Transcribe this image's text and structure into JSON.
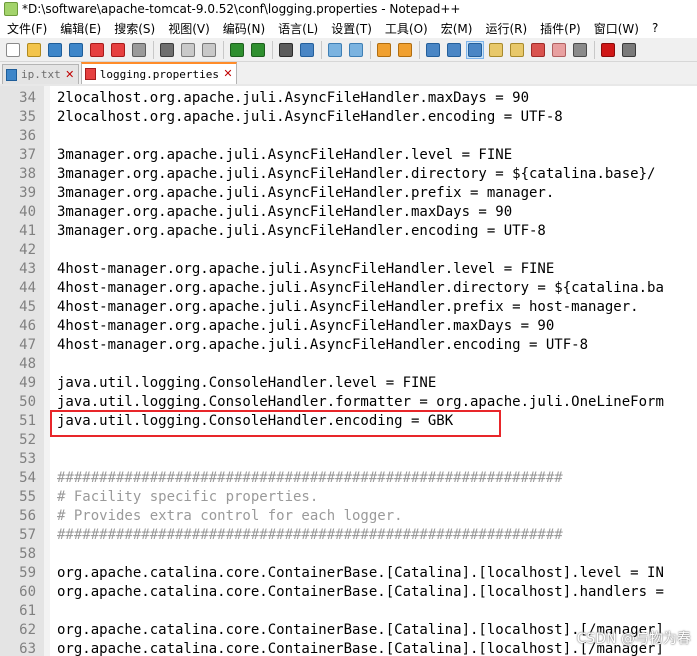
{
  "window": {
    "title": "*D:\\software\\apache-tomcat-9.0.52\\conf\\logging.properties - Notepad++"
  },
  "menubar": {
    "items": [
      "文件(F)",
      "编辑(E)",
      "搜索(S)",
      "视图(V)",
      "编码(N)",
      "语言(L)",
      "设置(T)",
      "工具(O)",
      "宏(M)",
      "运行(R)",
      "插件(P)",
      "窗口(W)",
      "?"
    ]
  },
  "toolbar": {
    "buttons": [
      {
        "icon": "new-file-icon",
        "color": "#ffffff",
        "border": "#8a8a8a"
      },
      {
        "icon": "open-file-icon",
        "color": "#f3c44b",
        "border": "#b08a1e"
      },
      {
        "icon": "save-icon",
        "color": "#3e86c9",
        "border": "#1e5d99"
      },
      {
        "icon": "save-all-icon",
        "color": "#3e86c9",
        "border": "#1e5d99"
      },
      {
        "icon": "close-file-icon",
        "color": "#e64040",
        "border": "#a61b1b"
      },
      {
        "icon": "close-all-icon",
        "color": "#e64040",
        "border": "#a61b1b"
      },
      {
        "icon": "print-icon",
        "color": "#9a9a9a",
        "border": "#5c5c5c"
      },
      {
        "sep": true
      },
      {
        "icon": "cut-icon",
        "color": "#6f6f6f",
        "border": "#3c3c3c"
      },
      {
        "icon": "copy-icon",
        "color": "#c9c9c9",
        "border": "#7a7a7a"
      },
      {
        "icon": "paste-icon",
        "color": "#c9c9c9",
        "border": "#7a7a7a"
      },
      {
        "sep": true
      },
      {
        "icon": "undo-icon",
        "color": "#2f8f2f",
        "border": "#1d5e1d"
      },
      {
        "icon": "redo-icon",
        "color": "#2f8f2f",
        "border": "#1d5e1d"
      },
      {
        "sep": true
      },
      {
        "icon": "find-icon",
        "color": "#5c5c5c",
        "border": "#2c2c2c"
      },
      {
        "icon": "replace-icon",
        "color": "#4a86c5",
        "border": "#245f9b"
      },
      {
        "sep": true
      },
      {
        "icon": "zoom-in-icon",
        "color": "#7bb3e0",
        "border": "#3f7fb5"
      },
      {
        "icon": "zoom-out-icon",
        "color": "#7bb3e0",
        "border": "#3f7fb5"
      },
      {
        "sep": true
      },
      {
        "icon": "sync-vertical-icon",
        "color": "#f0a030",
        "border": "#b06d10"
      },
      {
        "icon": "sync-horizontal-icon",
        "color": "#f0a030",
        "border": "#b06d10"
      },
      {
        "sep": true
      },
      {
        "icon": "word-wrap-icon",
        "color": "#4a86c5",
        "border": "#245f9b"
      },
      {
        "icon": "show-all-chars-icon",
        "color": "#4a86c5",
        "border": "#245f9b"
      },
      {
        "icon": "indent-guide-icon",
        "color": "#4a86c5",
        "border": "#245f9b",
        "active": true
      },
      {
        "icon": "define-language-icon",
        "color": "#e8c86a",
        "border": "#a88a2c"
      },
      {
        "icon": "document-map-icon",
        "color": "#e8c86a",
        "border": "#a88a2c"
      },
      {
        "icon": "function-list-icon",
        "color": "#d9534f",
        "border": "#9e2b28"
      },
      {
        "icon": "folder-workspace-icon",
        "color": "#e8a0a0",
        "border": "#b06060"
      },
      {
        "icon": "monitoring-icon",
        "color": "#8a8a8a",
        "border": "#4a4a4a"
      },
      {
        "sep": true
      },
      {
        "icon": "record-macro-icon",
        "color": "#d01818",
        "border": "#8a0c0c"
      },
      {
        "icon": "stop-macro-icon",
        "color": "#7a7a7a",
        "border": "#3a3a3a"
      }
    ]
  },
  "tabs": [
    {
      "label": "ip.txt",
      "state": "saved",
      "active": false,
      "close": "✕"
    },
    {
      "label": "logging.properties",
      "state": "unsaved",
      "active": true,
      "close": "✕"
    }
  ],
  "editor": {
    "lines": [
      {
        "n": "34",
        "text": "2localhost.org.apache.juli.AsyncFileHandler.maxDays = 90",
        "comment": false
      },
      {
        "n": "35",
        "text": "2localhost.org.apache.juli.AsyncFileHandler.encoding = UTF-8",
        "comment": false
      },
      {
        "n": "36",
        "text": "",
        "comment": false
      },
      {
        "n": "37",
        "text": "3manager.org.apache.juli.AsyncFileHandler.level = FINE",
        "comment": false
      },
      {
        "n": "38",
        "text": "3manager.org.apache.juli.AsyncFileHandler.directory = ${catalina.base}/",
        "comment": false
      },
      {
        "n": "39",
        "text": "3manager.org.apache.juli.AsyncFileHandler.prefix = manager.",
        "comment": false
      },
      {
        "n": "40",
        "text": "3manager.org.apache.juli.AsyncFileHandler.maxDays = 90",
        "comment": false
      },
      {
        "n": "41",
        "text": "3manager.org.apache.juli.AsyncFileHandler.encoding = UTF-8",
        "comment": false
      },
      {
        "n": "42",
        "text": "",
        "comment": false
      },
      {
        "n": "43",
        "text": "4host-manager.org.apache.juli.AsyncFileHandler.level = FINE",
        "comment": false
      },
      {
        "n": "44",
        "text": "4host-manager.org.apache.juli.AsyncFileHandler.directory = ${catalina.ba",
        "comment": false
      },
      {
        "n": "45",
        "text": "4host-manager.org.apache.juli.AsyncFileHandler.prefix = host-manager.",
        "comment": false
      },
      {
        "n": "46",
        "text": "4host-manager.org.apache.juli.AsyncFileHandler.maxDays = 90",
        "comment": false
      },
      {
        "n": "47",
        "text": "4host-manager.org.apache.juli.AsyncFileHandler.encoding = UTF-8",
        "comment": false
      },
      {
        "n": "48",
        "text": "",
        "comment": false
      },
      {
        "n": "49",
        "text": "java.util.logging.ConsoleHandler.level = FINE",
        "comment": false
      },
      {
        "n": "50",
        "text": "java.util.logging.ConsoleHandler.formatter = org.apache.juli.OneLineForm",
        "comment": false
      },
      {
        "n": "51",
        "text": "java.util.logging.ConsoleHandler.encoding = GBK",
        "comment": false
      },
      {
        "n": "52",
        "text": "",
        "comment": false
      },
      {
        "n": "53",
        "text": "",
        "comment": false
      },
      {
        "n": "54",
        "text": "############################################################",
        "comment": true
      },
      {
        "n": "55",
        "text": "# Facility specific properties.",
        "comment": true
      },
      {
        "n": "56",
        "text": "# Provides extra control for each logger.",
        "comment": true
      },
      {
        "n": "57",
        "text": "############################################################",
        "comment": true
      },
      {
        "n": "58",
        "text": "",
        "comment": false
      },
      {
        "n": "59",
        "text": "org.apache.catalina.core.ContainerBase.[Catalina].[localhost].level = IN",
        "comment": false
      },
      {
        "n": "60",
        "text": "org.apache.catalina.core.ContainerBase.[Catalina].[localhost].handlers =",
        "comment": false
      },
      {
        "n": "61",
        "text": "",
        "comment": false
      },
      {
        "n": "62",
        "text": "org.apache.catalina.core.ContainerBase.[Catalina].[localhost].[/manager]",
        "comment": false
      },
      {
        "n": "63",
        "text": "org.apache.catalina.core.ContainerBase.[Catalina].[localhost].[/manager]",
        "comment": false
      }
    ]
  },
  "watermark": "CSDN @与物为春"
}
